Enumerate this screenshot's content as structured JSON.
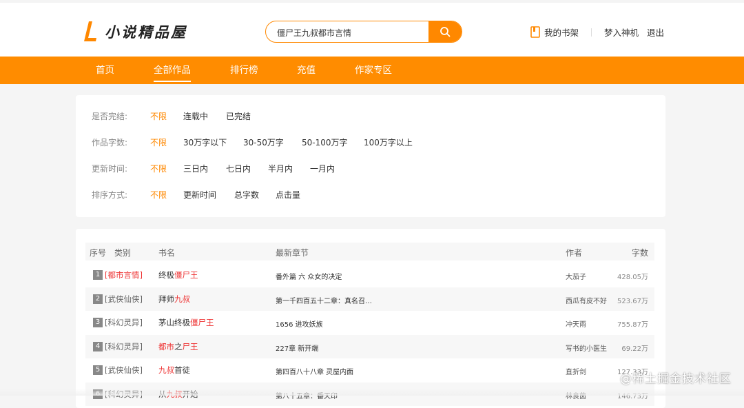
{
  "brand": {
    "letter": "L",
    "name": "小说精品屋",
    "accent": "#ff8800"
  },
  "search": {
    "value": "僵尸王九叔都市言情",
    "icon": "search-icon"
  },
  "user": {
    "shelf": "我的书架",
    "username": "梦入神机",
    "logout": "退出"
  },
  "nav": [
    {
      "label": "首页"
    },
    {
      "label": "全部作品"
    },
    {
      "label": "排行榜"
    },
    {
      "label": "充值"
    },
    {
      "label": "作家专区"
    }
  ],
  "nav_active": "全部作品",
  "filters": [
    {
      "label": "是否完结:",
      "options": [
        "不限",
        "连载中",
        "已完结"
      ],
      "selected": "不限"
    },
    {
      "label": "作品字数:",
      "options": [
        "不限",
        "30万字以下",
        "30-50万字",
        "50-100万字",
        "100万字以上"
      ],
      "selected": "不限"
    },
    {
      "label": "更新时间:",
      "options": [
        "不限",
        "三日内",
        "七日内",
        "半月内",
        "一月内"
      ],
      "selected": "不限"
    },
    {
      "label": "排序方式:",
      "options": [
        "不限",
        "更新时间",
        "总字数",
        "点击量"
      ],
      "selected": "不限"
    }
  ],
  "table": {
    "headers": {
      "idx": "序号",
      "category": "类别",
      "title": "书名",
      "chapter": "最新章节",
      "author": "作者",
      "words": "字数"
    },
    "rows": [
      {
        "idx": "1",
        "category": [
          "[",
          "都市言情",
          "]"
        ],
        "category_hl": true,
        "title": [
          [
            "终极",
            false
          ],
          [
            "僵尸王",
            true
          ]
        ],
        "chapter": "番外篇 六 众女的决定",
        "author": "大茄子",
        "words": "428.05万"
      },
      {
        "idx": "2",
        "category": [
          "[",
          "武侠仙侠",
          "]"
        ],
        "category_hl": false,
        "title": [
          [
            "拜师",
            false
          ],
          [
            "九叔",
            true
          ]
        ],
        "chapter": "第一千四百五十二章：真名召…",
        "author": "西瓜有皮不好",
        "words": "523.67万"
      },
      {
        "idx": "3",
        "category": [
          "[",
          "科幻灵异",
          "]"
        ],
        "category_hl": false,
        "title": [
          [
            "茅山终极",
            false
          ],
          [
            "僵尸王",
            true
          ]
        ],
        "chapter": "1656 进攻妖族",
        "author": "冲天雨",
        "words": "755.87万"
      },
      {
        "idx": "4",
        "category": [
          "[",
          "科幻灵异",
          "]"
        ],
        "category_hl": false,
        "title": [
          [
            "都市",
            true
          ],
          [
            "之",
            false
          ],
          [
            "尸王",
            true
          ]
        ],
        "chapter": "227章 新开端",
        "author": "写书的小医生",
        "words": "69.22万"
      },
      {
        "idx": "5",
        "category": [
          "[",
          "武侠仙侠",
          "]"
        ],
        "category_hl": false,
        "title": [
          [
            "九叔",
            true
          ],
          [
            "首徒",
            false
          ]
        ],
        "chapter": "第四百八十八章 灵屋内面",
        "author": "直折剑",
        "words": "127.33万"
      },
      {
        "idx": "6",
        "category": [
          "[",
          "科幻灵异",
          "]"
        ],
        "category_hl": false,
        "title": [
          [
            "从",
            false
          ],
          [
            "九叔",
            true
          ],
          [
            "开始",
            false
          ]
        ],
        "chapter": "第八十五章：番天印",
        "author": "林良茵",
        "words": "146.73万"
      }
    ]
  },
  "watermark": "@稀土掘金技术社区"
}
